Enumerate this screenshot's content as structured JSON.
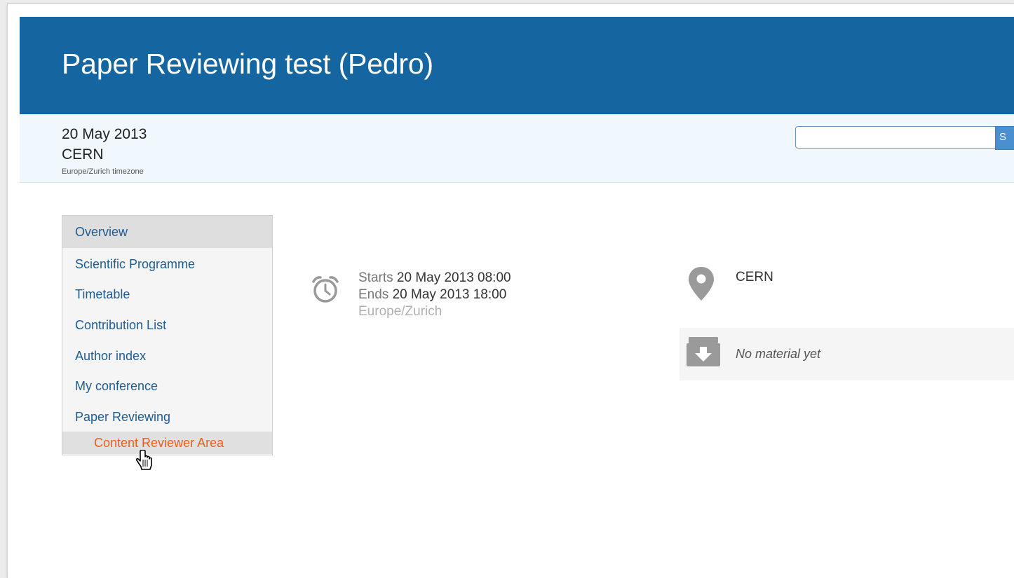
{
  "event": {
    "title": "Paper Reviewing test (Pedro)",
    "date": "20 May 2013",
    "location": "CERN",
    "timezone_note": "Europe/Zurich timezone"
  },
  "search": {
    "value": "",
    "placeholder": "",
    "button_label": "S"
  },
  "menu": {
    "items": [
      {
        "label": "Overview",
        "selected": true
      },
      {
        "label": "Scientific Programme"
      },
      {
        "label": "Timetable"
      },
      {
        "label": "Contribution List"
      },
      {
        "label": "Author index"
      },
      {
        "label": "My conference"
      },
      {
        "label": "Paper Reviewing"
      }
    ],
    "subitem": {
      "label": "Content Reviewer Area"
    }
  },
  "schedule": {
    "starts_label": "Starts",
    "starts_value": "20 May 2013 08:00",
    "ends_label": "Ends",
    "ends_value": "20 May 2013 18:00",
    "timezone": "Europe/Zurich",
    "icon": "alarm-clock-icon"
  },
  "venue": {
    "name": "CERN",
    "icon": "map-pin-icon"
  },
  "material": {
    "text": "No material yet",
    "icon": "download-box-icon"
  },
  "colors": {
    "header_bg": "#1565a0",
    "subheader_bg": "#f1f8fd",
    "link": "#1f5c94",
    "active_subitem": "#e8601c"
  }
}
